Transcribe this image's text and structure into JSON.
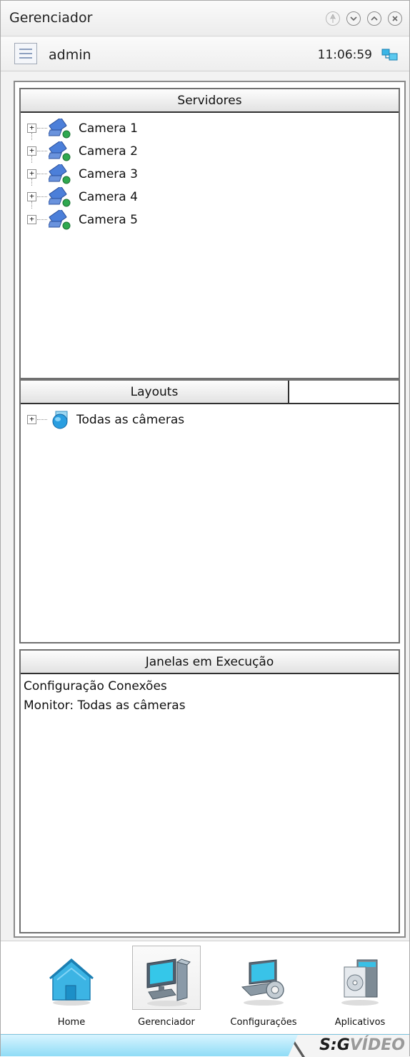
{
  "window": {
    "title": "Gerenciador",
    "buttons": [
      "pin-icon",
      "chevron-down-icon",
      "chevron-up-icon",
      "close-icon"
    ]
  },
  "user": {
    "name": "admin",
    "time": "11:06:59"
  },
  "panels": {
    "servers": {
      "title": "Servidores",
      "items": [
        {
          "label": "Camera 1",
          "icon": "camera-server-icon"
        },
        {
          "label": "Camera 2",
          "icon": "camera-server-icon"
        },
        {
          "label": "Camera 3",
          "icon": "camera-server-icon"
        },
        {
          "label": "Camera 4",
          "icon": "camera-server-icon"
        },
        {
          "label": "Camera 5",
          "icon": "camera-server-icon"
        }
      ]
    },
    "layouts": {
      "title": "Layouts",
      "items": [
        {
          "label": "Todas as câmeras",
          "icon": "layout-globe-icon"
        }
      ]
    },
    "running": {
      "title": "Janelas em Execução",
      "items": [
        "Configuração Conexões",
        "Monitor: Todas as câmeras"
      ]
    }
  },
  "nav": [
    {
      "label": "Home",
      "icon": "home-icon",
      "active": false
    },
    {
      "label": "Gerenciador",
      "icon": "computer-icon",
      "active": true
    },
    {
      "label": "Configurações",
      "icon": "settings-laptop-icon",
      "active": false
    },
    {
      "label": "Aplicativos",
      "icon": "applications-icon",
      "active": false
    }
  ],
  "footer": {
    "logo_part1": "S:G",
    "logo_part2": "VÍDEO"
  },
  "colors": {
    "footer_gradient_top": "#d8f4ff",
    "footer_gradient_bottom": "#8fdcf6",
    "accent_blue": "#1f9ad6"
  }
}
